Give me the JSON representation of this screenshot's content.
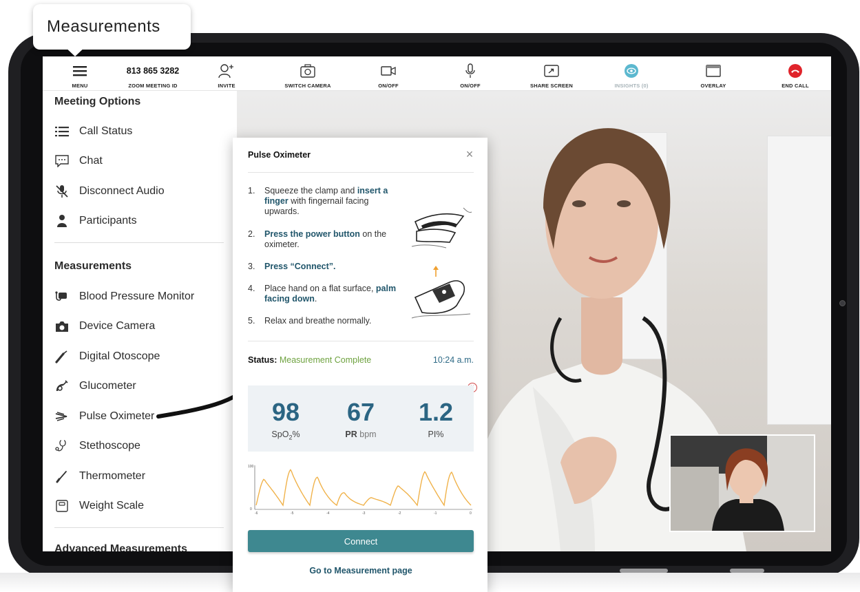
{
  "callout": {
    "text": "Measurements"
  },
  "toolbar": {
    "menu_label": "MENU",
    "meeting_id": "813 865 3282",
    "meeting_id_label": "ZOOM MEETING ID",
    "invite_label": "INVITE",
    "switch_camera_label": "SWITCH CAMERA",
    "video_label": "ON/OFF",
    "mic_label": "ON/OFF",
    "share_label": "SHARE SCREEN",
    "insights_label": "INSIGHTS (0)",
    "overlay_label": "OVERLAY",
    "end_call_label": "END CALL",
    "insights_color": "#5cb8cf",
    "end_call_color": "#e0242b"
  },
  "sidebar": {
    "meeting_options_heading": "Meeting Options",
    "meeting_options": [
      {
        "label": "Call Status",
        "icon": "list-icon"
      },
      {
        "label": "Chat",
        "icon": "chat-icon"
      },
      {
        "label": "Disconnect Audio",
        "icon": "mic-off-icon"
      },
      {
        "label": "Participants",
        "icon": "person-icon"
      }
    ],
    "measurements_heading": "Measurements",
    "measurements": [
      {
        "label": "Blood Pressure Monitor",
        "icon": "blood-pressure-icon"
      },
      {
        "label": "Device Camera",
        "icon": "camera-icon"
      },
      {
        "label": "Digital Otoscope",
        "icon": "otoscope-icon"
      },
      {
        "label": "Glucometer",
        "icon": "glucometer-icon"
      },
      {
        "label": "Pulse Oximeter",
        "icon": "pulse-oximeter-icon"
      },
      {
        "label": "Stethoscope",
        "icon": "stethoscope-icon"
      },
      {
        "label": "Thermometer",
        "icon": "thermometer-icon"
      },
      {
        "label": "Weight Scale",
        "icon": "scale-icon"
      }
    ],
    "advanced_heading": "Advanced Measurements"
  },
  "modal": {
    "title": "Pulse Oximeter",
    "steps": [
      {
        "num": "1.",
        "pre": "Squeeze the clamp and ",
        "bold": "insert a finger",
        "post": " with fingernail facing upwards."
      },
      {
        "num": "2.",
        "pre": "",
        "bold": "Press the power button",
        "post": " on the oximeter."
      },
      {
        "num": "3.",
        "pre": "",
        "bold": "Press “Connect”.",
        "post": ""
      },
      {
        "num": "4.",
        "pre": "Place hand on a flat surface, ",
        "bold": "palm facing down",
        "post": "."
      },
      {
        "num": "5.",
        "pre": "Relax and breathe normally.",
        "bold": "",
        "post": ""
      }
    ],
    "status_label": "Status:",
    "status_value": "Measurement Complete",
    "status_time": "10:24 a.m.",
    "readings": [
      {
        "value": "98",
        "label": "SpO",
        "sub": "2",
        "unit": "%"
      },
      {
        "value": "67",
        "label": "PR",
        "sub": "",
        "unit": " bpm"
      },
      {
        "value": "1.2",
        "label": "PI%",
        "sub": "",
        "unit": ""
      }
    ],
    "waveform": {
      "y_top_tick": "100",
      "y_bottom_tick": "0",
      "x_ticks": [
        "-6",
        "-5",
        "-4",
        "-3",
        "-2",
        "-1",
        "0"
      ],
      "color": "#f0b24a"
    },
    "connect_label": "Connect",
    "goto_label": "Go to Measurement page"
  }
}
